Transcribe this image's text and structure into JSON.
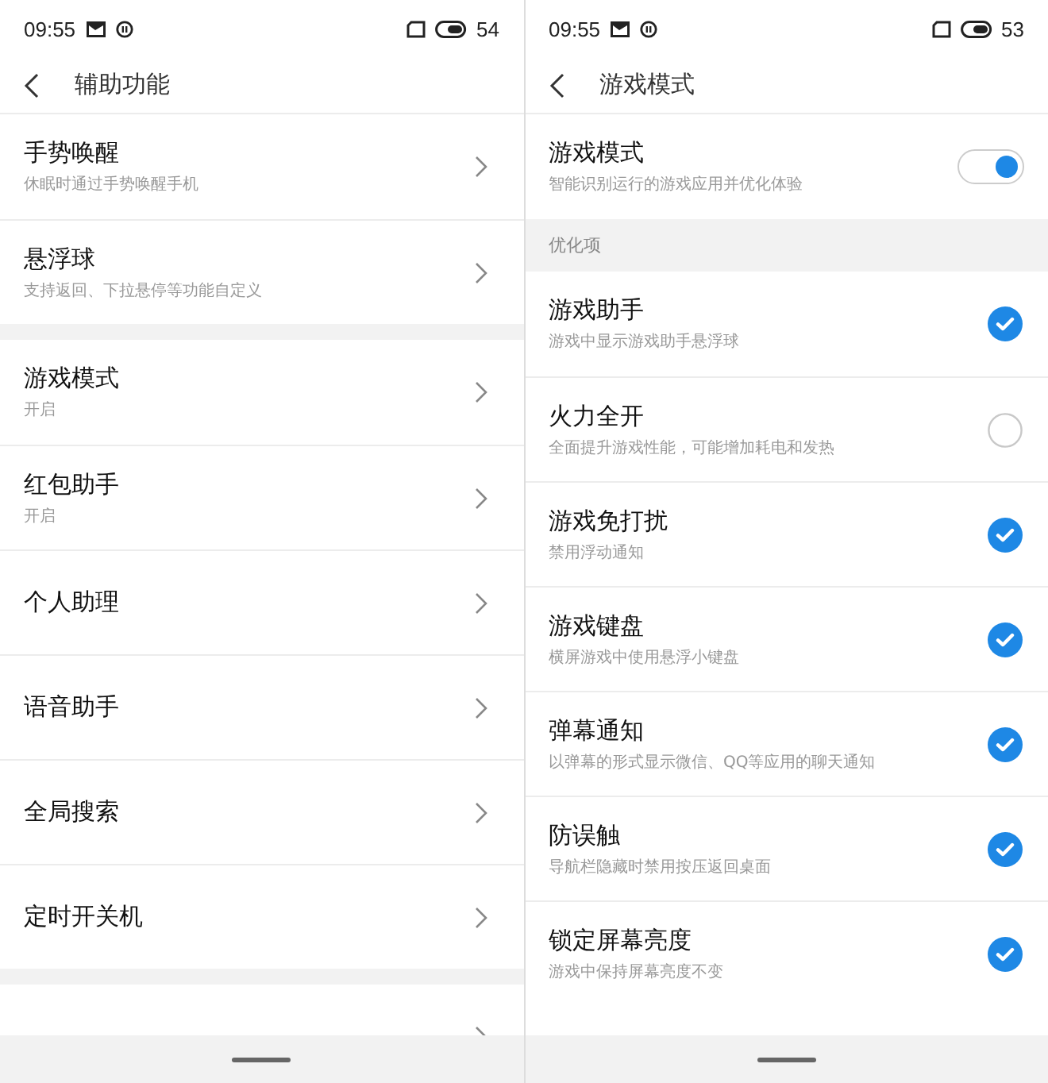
{
  "panels": [
    {
      "status_bar": {
        "time": "09:55",
        "battery": "54"
      },
      "header": {
        "title": "辅助功能"
      },
      "sections": [
        {
          "items": [
            {
              "kind": "link",
              "title": "手势唤醒",
              "subtitle": "休眠时通过手势唤醒手机"
            },
            {
              "kind": "link",
              "title": "悬浮球",
              "subtitle": "支持返回、下拉悬停等功能自定义"
            }
          ]
        },
        {
          "items": [
            {
              "kind": "link",
              "title": "游戏模式",
              "subtitle": "开启"
            },
            {
              "kind": "link",
              "title": "红包助手",
              "subtitle": "开启"
            },
            {
              "kind": "link",
              "title": "个人助理"
            },
            {
              "kind": "link",
              "title": "语音助手"
            },
            {
              "kind": "link",
              "title": "全局搜索"
            },
            {
              "kind": "link",
              "title": "定时开关机"
            }
          ]
        },
        {
          "items": [
            {
              "kind": "link"
            }
          ]
        }
      ]
    },
    {
      "status_bar": {
        "time": "09:55",
        "battery": "53"
      },
      "header": {
        "title": "游戏模式"
      },
      "sections": [
        {
          "items": [
            {
              "kind": "toggle",
              "title": "游戏模式",
              "subtitle": "智能识别运行的游戏应用并优化体验",
              "on": true
            }
          ]
        },
        {
          "header": "优化项",
          "items": [
            {
              "kind": "check",
              "title": "游戏助手",
              "subtitle": "游戏中显示游戏助手悬浮球",
              "checked": true
            },
            {
              "kind": "check",
              "title": "火力全开",
              "subtitle": "全面提升游戏性能，可能增加耗电和发热",
              "checked": false
            },
            {
              "kind": "check",
              "title": "游戏免打扰",
              "subtitle": "禁用浮动通知",
              "checked": true
            },
            {
              "kind": "check",
              "title": "游戏键盘",
              "subtitle": "横屏游戏中使用悬浮小键盘",
              "checked": true
            },
            {
              "kind": "check",
              "title": "弹幕通知",
              "subtitle": "以弹幕的形式显示微信、QQ等应用的聊天通知",
              "checked": true
            },
            {
              "kind": "check",
              "title": "防误触",
              "subtitle": "导航栏隐藏时禁用按压返回桌面",
              "checked": true
            },
            {
              "kind": "check",
              "title": "锁定屏幕亮度",
              "subtitle": "游戏中保持屏幕亮度不变",
              "checked": true
            }
          ]
        }
      ]
    }
  ]
}
